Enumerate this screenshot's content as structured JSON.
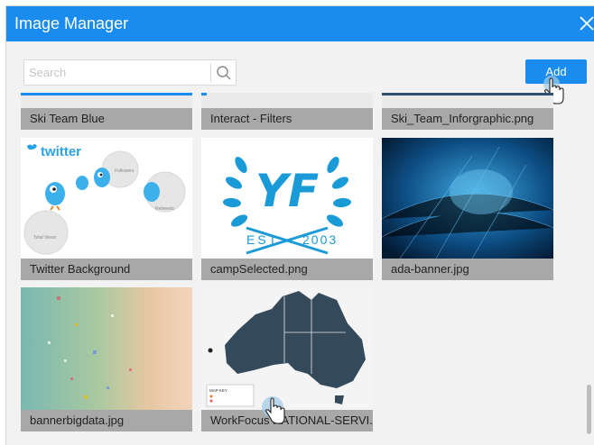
{
  "dialog": {
    "title": "Image Manager",
    "close_icon": "close-icon"
  },
  "search": {
    "placeholder": "Search",
    "value": "",
    "icon": "search-icon"
  },
  "toolbar": {
    "add_label": "Add"
  },
  "images": [
    {
      "name": "Ski Team Blue"
    },
    {
      "name": "Interact - Filters"
    },
    {
      "name": "Ski_Team_Inforgraphic.png"
    },
    {
      "name": "Twitter Background"
    },
    {
      "name": "campSelected.png"
    },
    {
      "name": "ada-banner.jpg"
    },
    {
      "name": "bannerbigdata.jpg"
    },
    {
      "name": "WorkFocus NATIONAL-SERVI..."
    }
  ],
  "thumbs": {
    "twitter_logo": "twitter",
    "bubble_followers": "Followers",
    "bubble_retweets": "Retweets",
    "bubble_total_views": "Total Views",
    "camp_logo": "YF",
    "camp_est": "EST",
    "camp_year": "2003",
    "map_key": "MAP KEY"
  },
  "colors": {
    "accent": "#1a8cf0",
    "label_bg": "#a8a8a8",
    "panel_bg": "#f2f2f2"
  }
}
